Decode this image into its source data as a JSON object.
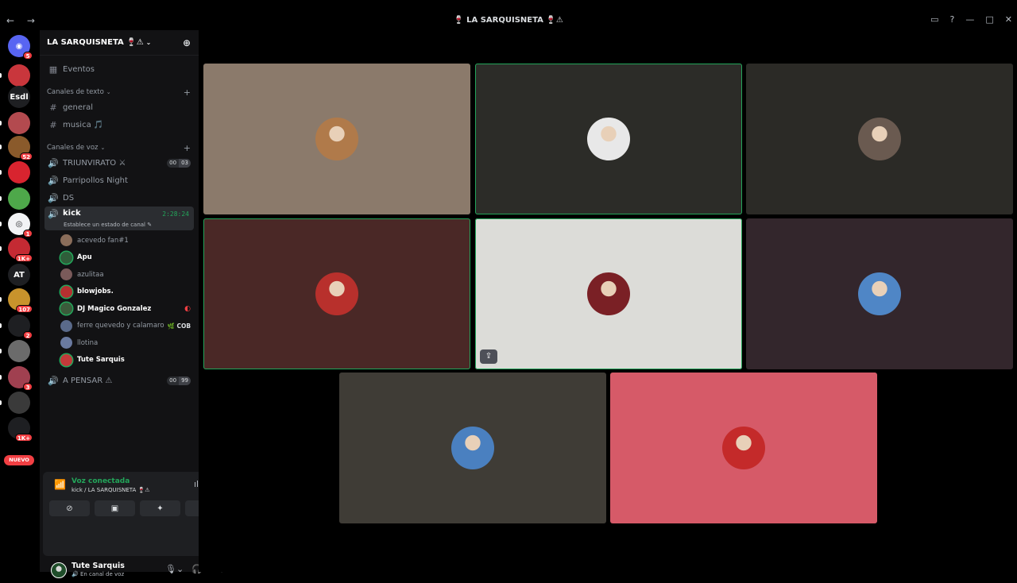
{
  "window": {
    "title": "🍷 LA SARQUISNETA 🍷⚠",
    "nav_icons": "← →",
    "controls": [
      "▭",
      "?",
      "—",
      "□",
      "✕"
    ]
  },
  "guilds": {
    "items": [
      {
        "name": "discord-home",
        "glyph": "◉",
        "color": "#5865f2",
        "badge": "5"
      },
      {
        "name": "guild-1",
        "glyph": "",
        "color": "#c9363c",
        "badge": ""
      },
      {
        "name": "guild-esdl",
        "glyph": "Esdl",
        "color": "#1e1f22",
        "badge": ""
      },
      {
        "name": "guild-3",
        "glyph": "",
        "color": "#b34a4f",
        "badge": ""
      },
      {
        "name": "guild-4",
        "glyph": "",
        "color": "#8a5a2b",
        "badge": "52"
      },
      {
        "name": "guild-5",
        "glyph": "",
        "color": "#d8242f",
        "badge": ""
      },
      {
        "name": "guild-6",
        "glyph": "",
        "color": "#4ea84a",
        "badge": ""
      },
      {
        "name": "guild-7",
        "glyph": "◎",
        "color": "#f2f3f5",
        "badge": "1"
      },
      {
        "name": "guild-8",
        "glyph": "",
        "color": "#c42a33",
        "badge": "1K+"
      },
      {
        "name": "guild-at",
        "glyph": "AT",
        "color": "#1e1f22",
        "badge": ""
      },
      {
        "name": "guild-10",
        "glyph": "",
        "color": "#c8932c",
        "badge": "107"
      },
      {
        "name": "guild-11",
        "glyph": "",
        "color": "#1e1f22",
        "badge": "2"
      },
      {
        "name": "guild-12",
        "glyph": "",
        "color": "#6b6b6b",
        "badge": ""
      },
      {
        "name": "guild-13",
        "glyph": "",
        "color": "#a04050",
        "badge": "3"
      },
      {
        "name": "guild-14",
        "glyph": "",
        "color": "#3a3a3a",
        "badge": ""
      },
      {
        "name": "guild-15",
        "glyph": "",
        "color": "#1e1f22",
        "badge": "1K+"
      }
    ],
    "new_label": "NUEVO"
  },
  "server": {
    "name": "LA SARQUISNETA 🍷⚠",
    "events_label": "Eventos",
    "text_category": "Canales de texto",
    "text_channels": [
      {
        "name": "general"
      },
      {
        "name": "musica 🎵"
      }
    ],
    "voice_category": "Canales de voz",
    "voice_channels_top": [
      {
        "name": "TRIUNVIRATO ⚔",
        "count": "00",
        "limit": "03"
      },
      {
        "name": "Parripollos Night",
        "count": "",
        "limit": ""
      },
      {
        "name": "DS",
        "count": "",
        "limit": ""
      }
    ],
    "active_channel": {
      "name": "kick",
      "status": "Establece un estado de canal ✎",
      "timer": "2:28:24"
    },
    "voice_users": [
      {
        "name": "acevedo fan#1",
        "speaking": false,
        "tag": "",
        "color": "#8a6d5a"
      },
      {
        "name": "Apu",
        "speaking": true,
        "tag": "",
        "color": "#2f5e3a"
      },
      {
        "name": "azulitaa",
        "speaking": false,
        "tag": "",
        "color": "#7a5a5a"
      },
      {
        "name": "blowjobs.",
        "speaking": true,
        "tag": "",
        "color": "#b53030"
      },
      {
        "name": "DJ Magico Gonzalez",
        "speaking": true,
        "tag": "",
        "color": "#3b5b3b"
      },
      {
        "name": "ferre quevedo y calamaro",
        "speaking": false,
        "tag": "🌿 COB",
        "color": "#5a6a8a"
      },
      {
        "name": "llotina",
        "speaking": false,
        "tag": "",
        "color": "#6a7aa0"
      },
      {
        "name": "Tute Sarquis",
        "speaking": true,
        "tag": "",
        "color": "#c23a3a"
      }
    ],
    "voice_channels_bottom": [
      {
        "name": "A PENSAR ⚠",
        "count": "00",
        "limit": "99"
      }
    ]
  },
  "voice_panel": {
    "status": "Voz conectada",
    "location": "kick / LA SARQUISNETA 🍷⚠"
  },
  "user": {
    "name": "Tute Sarquis",
    "status": "🔊 En canal de voz"
  },
  "tiles": [
    {
      "name": "tile-1",
      "bg": "#8b7a6b",
      "talking": false,
      "avatar": "#b07a4a",
      "share": false
    },
    {
      "name": "tile-2",
      "bg": "#2c2c28",
      "talking": true,
      "avatar": "#e8e8e8",
      "share": false
    },
    {
      "name": "tile-3",
      "bg": "#2b2a26",
      "talking": false,
      "avatar": "#6a5a50",
      "share": false
    },
    {
      "name": "tile-4",
      "bg": "#4a2826",
      "talking": true,
      "avatar": "#b8302c",
      "share": false
    },
    {
      "name": "tile-5",
      "bg": "#dcdcd8",
      "talking": true,
      "avatar": "#7a2025",
      "share": true
    },
    {
      "name": "tile-6",
      "bg": "#33262c",
      "talking": false,
      "avatar": "#4f86c6",
      "share": false
    },
    {
      "name": "tile-7",
      "bg": "#3f3c36",
      "talking": false,
      "avatar": "#4a80c0",
      "share": false
    },
    {
      "name": "tile-8",
      "bg": "#d65a68",
      "talking": false,
      "avatar": "#c42a2a",
      "share": false
    }
  ]
}
